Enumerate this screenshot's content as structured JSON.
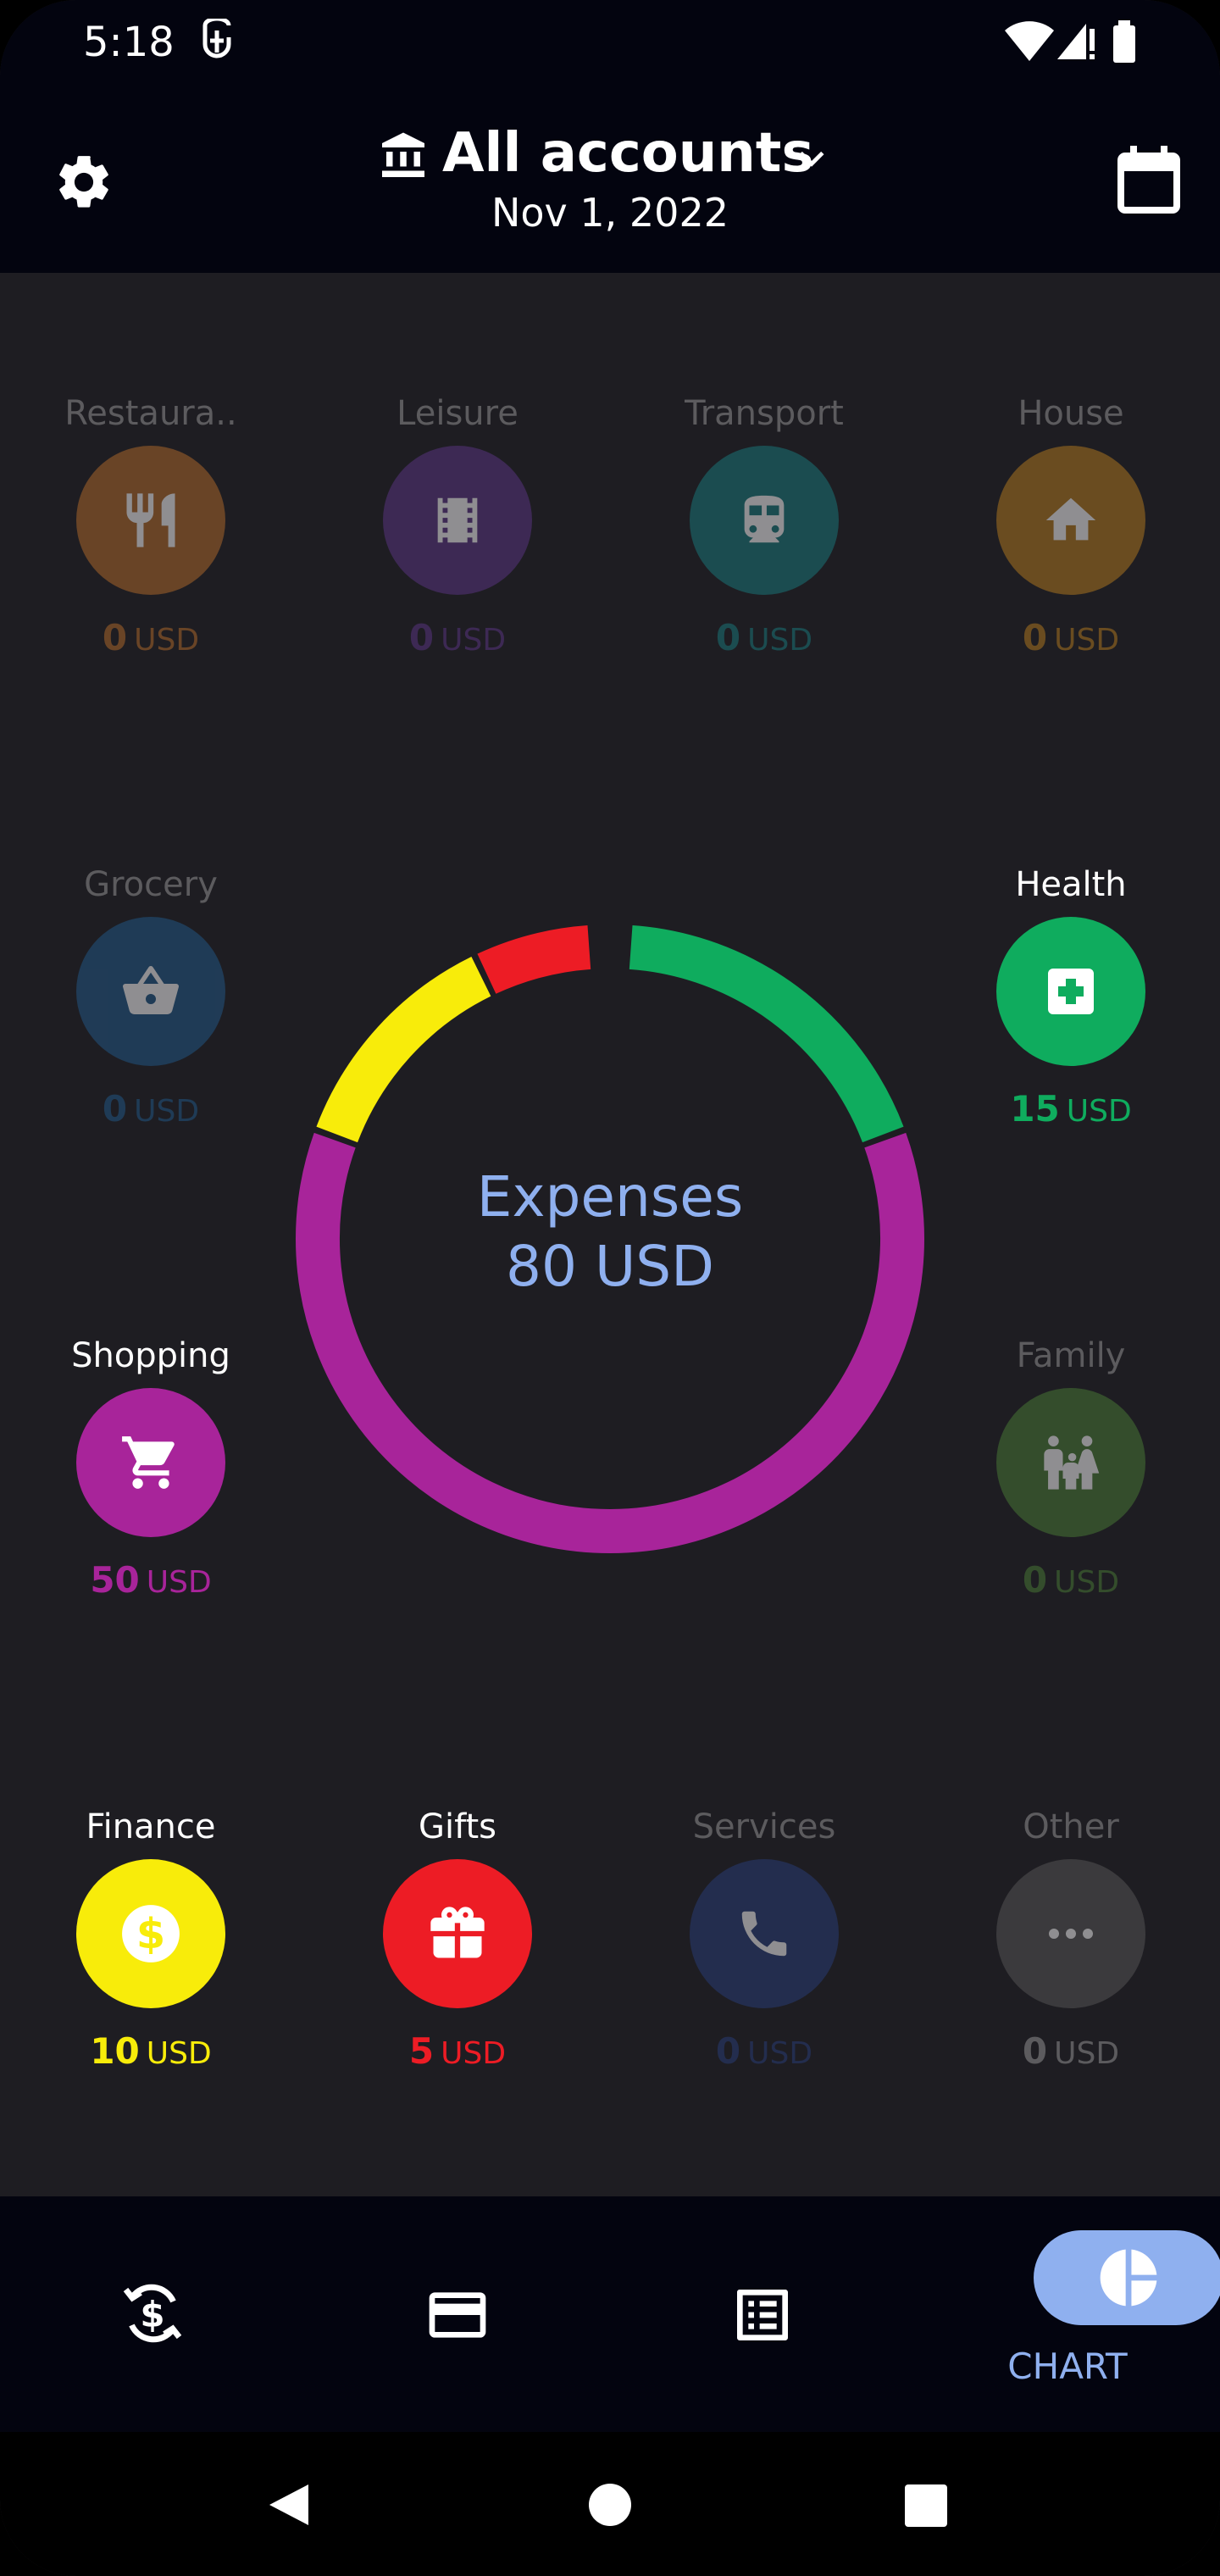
{
  "status_bar": {
    "time": "5:18"
  },
  "header": {
    "account_label": "All accounts",
    "date": "Nov 1, 2022",
    "icons": [
      "settings-icon",
      "bank-icon",
      "chevron-down-icon",
      "calendar-icon"
    ]
  },
  "categories": [
    {
      "label": "Restaura..",
      "amount": "0",
      "currency": "USD",
      "icon": "restaurant-icon",
      "color": "#b36b2b",
      "active": false
    },
    {
      "label": "Leisure",
      "amount": "0",
      "currency": "USD",
      "icon": "film-icon",
      "color": "#5c3587",
      "active": false
    },
    {
      "label": "Transport",
      "amount": "0",
      "currency": "USD",
      "icon": "train-icon",
      "color": "#1a7c7f",
      "active": false
    },
    {
      "label": "House",
      "amount": "0",
      "currency": "USD",
      "icon": "house-icon",
      "color": "#b57c1f",
      "active": false
    },
    {
      "label": "Grocery",
      "amount": "0",
      "currency": "USD",
      "icon": "basket-icon",
      "color": "#215a8a",
      "active": false
    },
    {
      "label": "Health",
      "amount": "15",
      "currency": "USD",
      "icon": "medical-icon",
      "color": "#0fac5e",
      "active": true
    },
    {
      "label": "Shopping",
      "amount": "50",
      "currency": "USD",
      "icon": "cart-icon",
      "color": "#a8249a",
      "active": true
    },
    {
      "label": "Family",
      "amount": "0",
      "currency": "USD",
      "icon": "family-icon",
      "color": "#4b7e36",
      "active": false
    },
    {
      "label": "Finance",
      "amount": "10",
      "currency": "USD",
      "icon": "dollar-icon",
      "color": "#f8ec0a",
      "active": true
    },
    {
      "label": "Gifts",
      "amount": "5",
      "currency": "USD",
      "icon": "gift-icon",
      "color": "#ed1c25",
      "active": true
    },
    {
      "label": "Services",
      "amount": "0",
      "currency": "USD",
      "icon": "phone-icon",
      "color": "#283d7a",
      "active": false
    },
    {
      "label": "Other",
      "amount": "0",
      "currency": "USD",
      "icon": "more-icon",
      "color": "#585858",
      "active": false
    }
  ],
  "summary": {
    "title": "Expenses",
    "total": "80 USD"
  },
  "chart_data": {
    "type": "pie",
    "donut": true,
    "total": 80,
    "slices": [
      {
        "name": "Health",
        "value": 15,
        "color": "#0fac5e"
      },
      {
        "name": "Shopping",
        "value": 50,
        "color": "#a8249a"
      },
      {
        "name": "Finance",
        "value": 10,
        "color": "#f8ec0a"
      },
      {
        "name": "Gifts",
        "value": 5,
        "color": "#ed1c25"
      }
    ]
  },
  "bottom_nav": {
    "items": [
      {
        "icon": "exchange-dollar-icon"
      },
      {
        "icon": "credit-card-icon"
      },
      {
        "icon": "list-icon"
      },
      {
        "icon": "pie-chart-icon",
        "label": "CHART",
        "selected": true
      }
    ]
  },
  "system_nav": [
    "back-icon",
    "home-icon",
    "recents-icon"
  ],
  "colors": {
    "background": "#1e1d22",
    "bar": "#03040f",
    "accent": "#8fb0ef"
  }
}
